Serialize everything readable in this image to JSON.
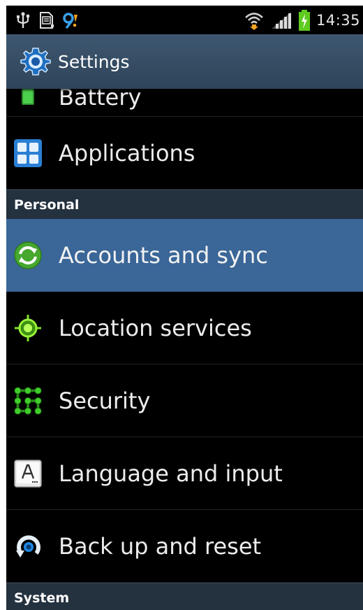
{
  "status_bar": {
    "time": "14:35",
    "icons": [
      "usb-icon",
      "sd-card-icon",
      "notification-icon",
      "wifi-icon",
      "signal-icon",
      "battery-charging-icon"
    ]
  },
  "action_bar": {
    "title": "Settings",
    "icon": "settings-gear-icon"
  },
  "list": {
    "items": [
      {
        "label": "Battery",
        "icon": "battery-icon"
      },
      {
        "label": "Applications",
        "icon": "applications-icon"
      }
    ],
    "personal_header": "Personal",
    "personal_items": [
      {
        "label": "Accounts and sync",
        "icon": "sync-icon",
        "selected": true
      },
      {
        "label": "Location services",
        "icon": "location-icon"
      },
      {
        "label": "Security",
        "icon": "security-icon"
      },
      {
        "label": "Language and input",
        "icon": "language-icon"
      },
      {
        "label": "Back up and reset",
        "icon": "backup-icon"
      }
    ],
    "system_header": "System"
  },
  "colors": {
    "action_bar": "#34495f",
    "selected_row": "#3a6698",
    "section_header": "#24313f",
    "background": "#000000"
  }
}
